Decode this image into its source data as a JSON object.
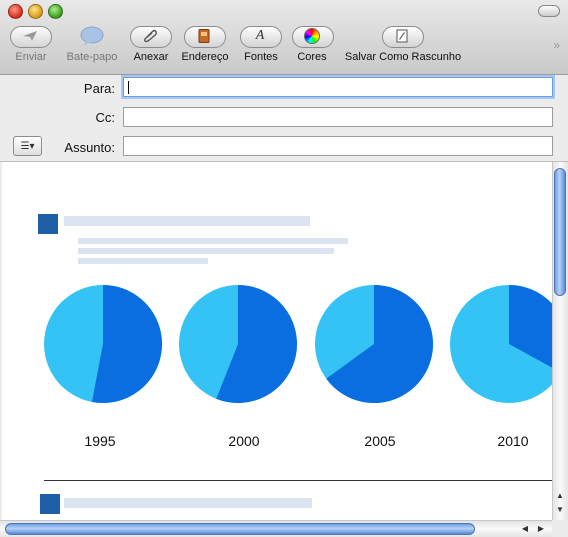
{
  "toolbar": {
    "send": "Enviar",
    "chat": "Bate-papo",
    "attach": "Anexar",
    "address": "Endereço",
    "fonts": "Fontes",
    "colors": "Cores",
    "save_draft": "Salvar Como Rascunho"
  },
  "header": {
    "to_label": "Para:",
    "to_value": "",
    "cc_label": "Cc:",
    "cc_value": "",
    "subject_label": "Assunto:",
    "subject_value": ""
  },
  "content": {
    "years": [
      "1995",
      "2000",
      "2005",
      "2010"
    ],
    "pie_colors": {
      "dark": "#0a6ee0",
      "light": "#35c3f6"
    },
    "dark_share": [
      0.53,
      0.56,
      0.65,
      0.33
    ]
  },
  "icons": {
    "send": "paper-plane-icon",
    "chat": "speech-bubble-icon",
    "attach": "paperclip-icon",
    "address": "address-book-icon",
    "fonts": "font-a-icon",
    "colors": "color-wheel-icon",
    "save_draft": "draft-icon"
  }
}
